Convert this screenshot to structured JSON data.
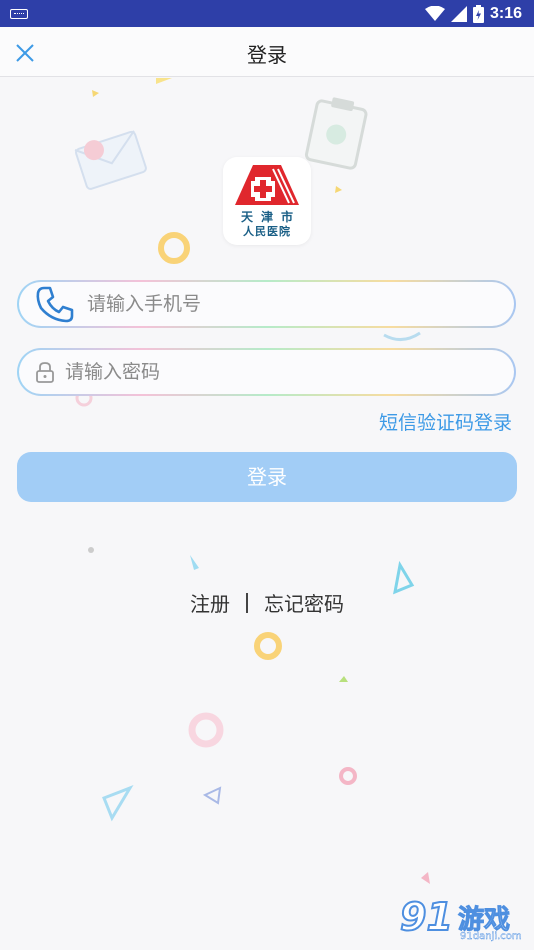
{
  "status_bar": {
    "time": "3:16"
  },
  "header": {
    "title": "登录"
  },
  "logo": {
    "line1": "天津市",
    "line2": "人民医院"
  },
  "form": {
    "phone_placeholder": "请输入手机号",
    "password_placeholder": "请输入密码",
    "sms_login_link": "短信验证码登录",
    "login_button": "登录"
  },
  "footer_links": {
    "register": "注册",
    "forgot_password": "忘记密码"
  },
  "watermark": {
    "number": "91",
    "name": "游戏",
    "url": "91danji.com"
  },
  "colors": {
    "status_bar": "#2e3fa8",
    "accent": "#3d9ae6",
    "button": "#a2cdf6",
    "logo_red": "#e0272d",
    "logo_text": "#1a5f86"
  }
}
